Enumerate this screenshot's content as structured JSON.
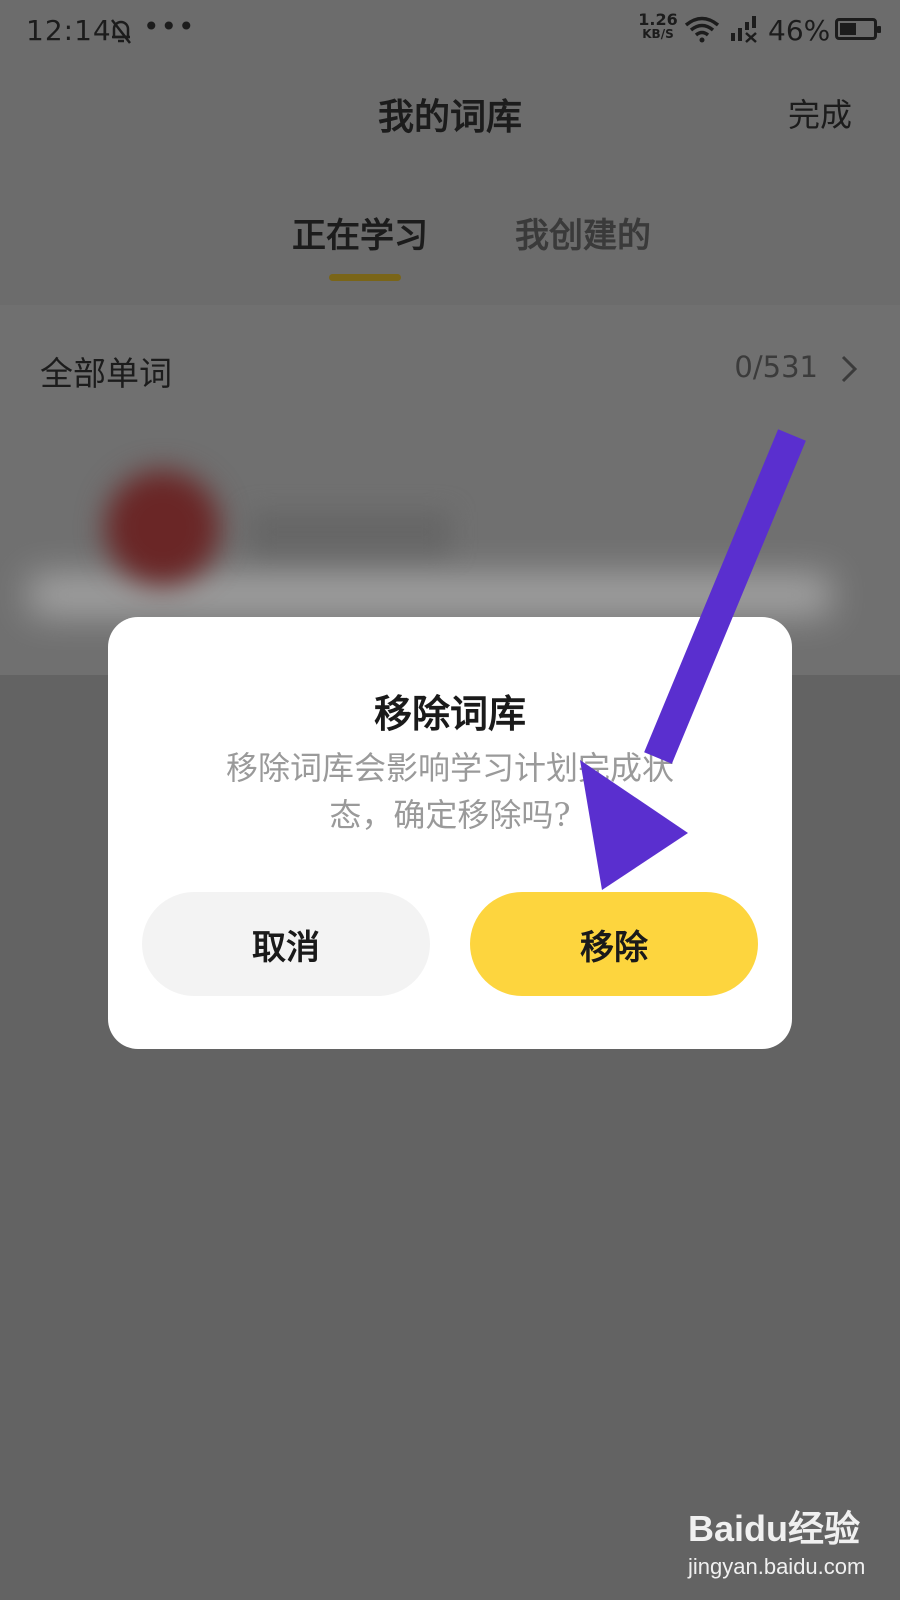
{
  "status_bar": {
    "time": "12:14",
    "overflow": "•••",
    "net_speed_value": "1.26",
    "net_speed_unit": "KB/S",
    "battery": "46%"
  },
  "header": {
    "title": "我的词库",
    "done": "完成"
  },
  "tabs": [
    {
      "label": "正在学习",
      "active": true
    },
    {
      "label": "我创建的",
      "active": false
    }
  ],
  "list": {
    "all_words_label": "全部单词",
    "progress": "0/531"
  },
  "dialog": {
    "title": "移除词库",
    "message_line1": "移除词库会影响学习计划完成状",
    "message_line2": "态，确定移除吗?",
    "cancel": "取消",
    "confirm": "移除"
  },
  "colors": {
    "confirm_button": "#fdd53e",
    "arrow": "#5a2fcf"
  },
  "watermark": {
    "brand": "Baidu经验",
    "url": "jingyan.baidu.com"
  }
}
